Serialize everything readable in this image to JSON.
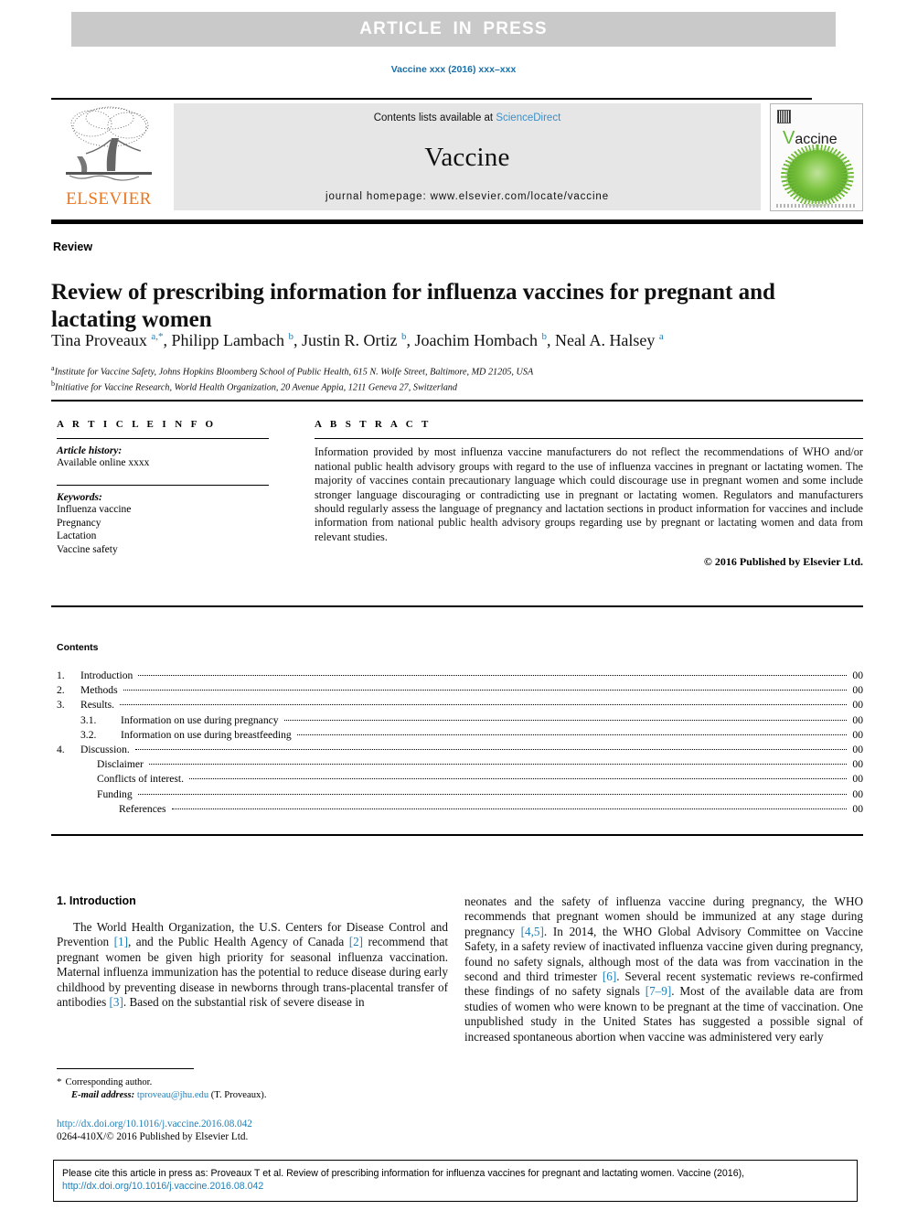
{
  "banner": {
    "text": "ARTICLE  IN  PRESS"
  },
  "journal_ref": "Vaccine xxx (2016) xxx–xxx",
  "masthead": {
    "contents_available_prefix": "Contents lists available at ",
    "sciencedirect": "ScienceDirect",
    "journal_name": "Vaccine",
    "homepage": "journal homepage: www.elsevier.com/locate/vaccine",
    "publisher_logo_text": "ELSEVIER",
    "cover_title_initial": "V",
    "cover_title_rest": "accine"
  },
  "article": {
    "doctype": "Review",
    "title": "Review of prescribing information for influenza vaccines for pregnant and lactating women",
    "authors_html": "Tina Proveaux <sup>a,*</sup>, Philipp Lambach <sup>b</sup>, Justin R. Ortiz <sup>b</sup>, Joachim Hombach <sup>b</sup>, Neal A. Halsey <sup>a</sup>",
    "affiliations": [
      {
        "marker": "a",
        "text": "Institute for Vaccine Safety, Johns Hopkins Bloomberg School of Public Health, 615 N. Wolfe Street, Baltimore, MD 21205, USA"
      },
      {
        "marker": "b",
        "text": "Initiative for Vaccine Research, World Health Organization, 20 Avenue Appia, 1211 Geneva 27, Switzerland"
      }
    ]
  },
  "article_info": {
    "heading": "A R T I C L E   I N F O",
    "history_label": "Article history:",
    "history_value": "Available online xxxx",
    "keywords_label": "Keywords:",
    "keywords": [
      "Influenza vaccine",
      "Pregnancy",
      "Lactation",
      "Vaccine safety"
    ]
  },
  "abstract": {
    "heading": "A B S T R A C T",
    "text": "Information provided by most influenza vaccine manufacturers do not reflect the recommendations of WHO and/or national public health advisory groups with regard to the use of influenza vaccines in pregnant or lactating women. The majority of vaccines contain precautionary language which could discourage use in pregnant women and some include stronger language discouraging or contradicting use in pregnant or lactating women. Regulators and manufacturers should regularly assess the language of pregnancy and lactation sections in product information for vaccines and include information from national public health advisory groups regarding use by pregnant or lactating women and data from relevant studies.",
    "copyright": "© 2016 Published by Elsevier Ltd."
  },
  "contents": {
    "heading": "Contents",
    "entries": [
      {
        "num": "1.",
        "label": "Introduction",
        "page": "00",
        "indent": 0
      },
      {
        "num": "2.",
        "label": "Methods",
        "page": "00",
        "indent": 0
      },
      {
        "num": "3.",
        "label": "Results.",
        "page": "00",
        "indent": 0
      },
      {
        "num": "3.1.",
        "label": "Information on use during pregnancy",
        "page": "00",
        "indent": 1
      },
      {
        "num": "3.2.",
        "label": "Information on use during breastfeeding",
        "page": "00",
        "indent": 1
      },
      {
        "num": "4.",
        "label": "Discussion.",
        "page": "00",
        "indent": 0
      },
      {
        "num": "",
        "label": "Disclaimer",
        "page": "00",
        "indent": 2
      },
      {
        "num": "",
        "label": "Conflicts of interest.",
        "page": "00",
        "indent": 2
      },
      {
        "num": "",
        "label": "Funding",
        "page": "00",
        "indent": 2
      },
      {
        "num": "",
        "label": "References",
        "page": "00",
        "indent": 3
      }
    ]
  },
  "body": {
    "section_heading": "1. Introduction",
    "left_column_html": "The World Health Organization, the U.S. Centers for Disease Control and Prevention <span class=\"ref\">[1]</span>, and the Public Health Agency of Canada <span class=\"ref\">[2]</span> recommend that pregnant women be given high priority for seasonal influenza vaccination. Maternal influenza immunization has the potential to reduce disease during early childhood by preventing disease in newborns through trans-placental transfer of antibodies <span class=\"ref\">[3]</span>. Based on the substantial risk of severe disease in",
    "right_column_html": "neonates and the safety of influenza vaccine during pregnancy, the WHO recommends that pregnant women should be immunized at any stage during pregnancy <span class=\"ref\">[4,5]</span>. In 2014, the WHO Global Advisory Committee on Vaccine Safety, in a safety review of inactivated influenza vaccine given during pregnancy, found no safety signals, although most of the data was from vaccination in the second and third trimester <span class=\"ref\">[6]</span>. Several recent systematic reviews re-confirmed these findings of no safety signals <span class=\"ref\">[7–9]</span>. Most of the available data are from studies of women who were known to be pregnant at the time of vaccination. One unpublished study in the United States has suggested a possible signal of increased spontaneous abortion when vaccine was administered very early"
  },
  "footnote": {
    "star": "*",
    "corresponding": "Corresponding author.",
    "email_label": "E-mail address:",
    "email": "tproveau@jhu.edu",
    "email_suffix": " (T. Proveaux).",
    "doi": "http://dx.doi.org/10.1016/j.vaccine.2016.08.042",
    "issn_line": "0264-410X/© 2016 Published by Elsevier Ltd."
  },
  "citation_box": {
    "text_before_link": "Please cite this article in press as: Proveaux T et al. Review of prescribing information for influenza vaccines for pregnant and lactating women. Vaccine (2016), ",
    "link": "http://dx.doi.org/10.1016/j.vaccine.2016.08.042"
  },
  "colors": {
    "link_blue": "#1f7fb8",
    "sciencedirect_blue": "#3a8fc8",
    "elsevier_orange": "#e87722",
    "banner_gray": "#c9c9c9",
    "masthead_gray": "#e6e6e6",
    "cover_green": "#5dba2e"
  }
}
